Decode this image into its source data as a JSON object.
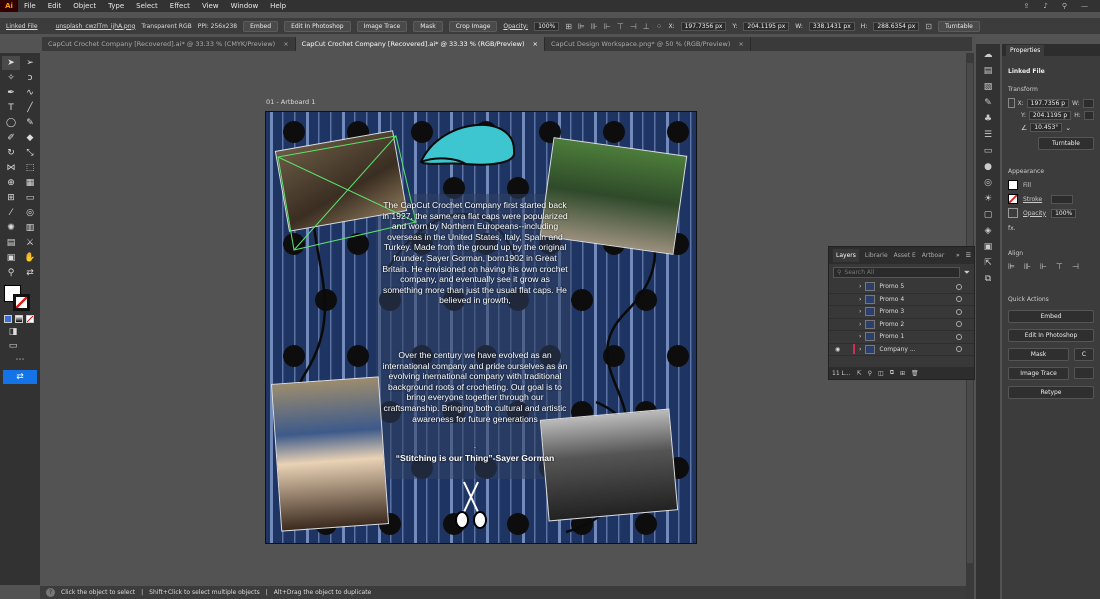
{
  "menubar": {
    "logo": "Ai",
    "items": [
      "File",
      "Edit",
      "Object",
      "Type",
      "Select",
      "Effect",
      "View",
      "Window",
      "Help"
    ]
  },
  "control_bar": {
    "mode": "Linked File",
    "filename": "unsplash_cwzlTm_ijhA.png",
    "color_mode": "Transparent RGB",
    "ppi": "PPI: 256x238",
    "embed": "Embed",
    "edit_photoshop": "Edit In Photoshop",
    "image_trace": "Image Trace",
    "mask": "Mask",
    "crop": "Crop Image",
    "opacity_label": "Opacity:",
    "opacity_value": "100%",
    "x_label": "X:",
    "x_value": "197.7356 px",
    "y_label": "Y:",
    "y_value": "204.1195 px",
    "w_label": "W:",
    "w_value": "338.1431 px",
    "h_label": "H:",
    "h_value": "288.6354 px",
    "turntable": "Turntable"
  },
  "tabs": [
    {
      "label": "CapCut Crochet Company [Recovered].ai* @ 33.33 % (CMYK/Preview)",
      "active": false
    },
    {
      "label": "CapCut Crochet Company [Recovered].ai* @ 33.33 % (RGB/Preview)",
      "active": true
    },
    {
      "label": "CapCut Design Workspace.png* @ 50 % (RGB/Preview)",
      "active": false
    }
  ],
  "artboard": {
    "label": "01 - Artboard 1",
    "paragraph1": "The CapCut Crochet Company first started back in 1927, the same era flat caps were popularized and worn by Northern Europeans--including overseas in the United States, Italy, Spain and Turkey. Made from the ground up by the original founder, Sayer Gorman, born1902 in Great Britain. He envisioned on having his own crochet company, and eventually see it grow as something more than just the usual flat caps. He believed in growth,",
    "paragraph2": "Over the century we have evolved as an international company and pride ourselves as an evolving inernational company with traditional background roots of crocheting. Our goal is to bring everyone together through our craftsmanship. Bringing both cultural and artistic awareness for future generations",
    "dot": ".",
    "quote": "“Stitching is our Thing”-Sayer Gorman"
  },
  "status_bar": {
    "help_icon": "?",
    "hint1": "Click the object to select",
    "hint2": "Shift+Click to select multiple objects",
    "hint3": "Alt+Drag the object to duplicate"
  },
  "layers_panel": {
    "tabs": [
      "Layers",
      "Librarie",
      "Asset E",
      "Artboar"
    ],
    "search_placeholder": "Search All",
    "rows": [
      "Promo 5",
      "Promo 4",
      "Promo 3",
      "Promo 2",
      "Promo 1",
      "Company ..."
    ],
    "footer_count": "11 L..."
  },
  "properties": {
    "title": "Properties",
    "linked_file": "Linked File",
    "transform_title": "Transform",
    "x_label": "X:",
    "x_value": "197.7356 p",
    "y_label": "Y:",
    "y_value": "204.1195 p",
    "w_label": "W:",
    "h_label": "H:",
    "angle_value": "10.453°",
    "turntable": "Turntable",
    "appearance_title": "Appearance",
    "fill": "Fill",
    "stroke": "Stroke",
    "opacity": "Opacity",
    "opacity_value": "100%",
    "fx": "fx.",
    "align_title": "Align",
    "quick_actions_title": "Quick Actions",
    "embed": "Embed",
    "edit_photoshop": "Edit In Photoshop",
    "mask": "Mask",
    "crop_short": "C",
    "image_trace": "Image Trace",
    "retype": "Retype"
  },
  "colors": {
    "artboard_bg": "#1e3462",
    "stripe_light": "#8fa8d8",
    "hat": "#3ec6d0",
    "selection": "#5be36a"
  }
}
